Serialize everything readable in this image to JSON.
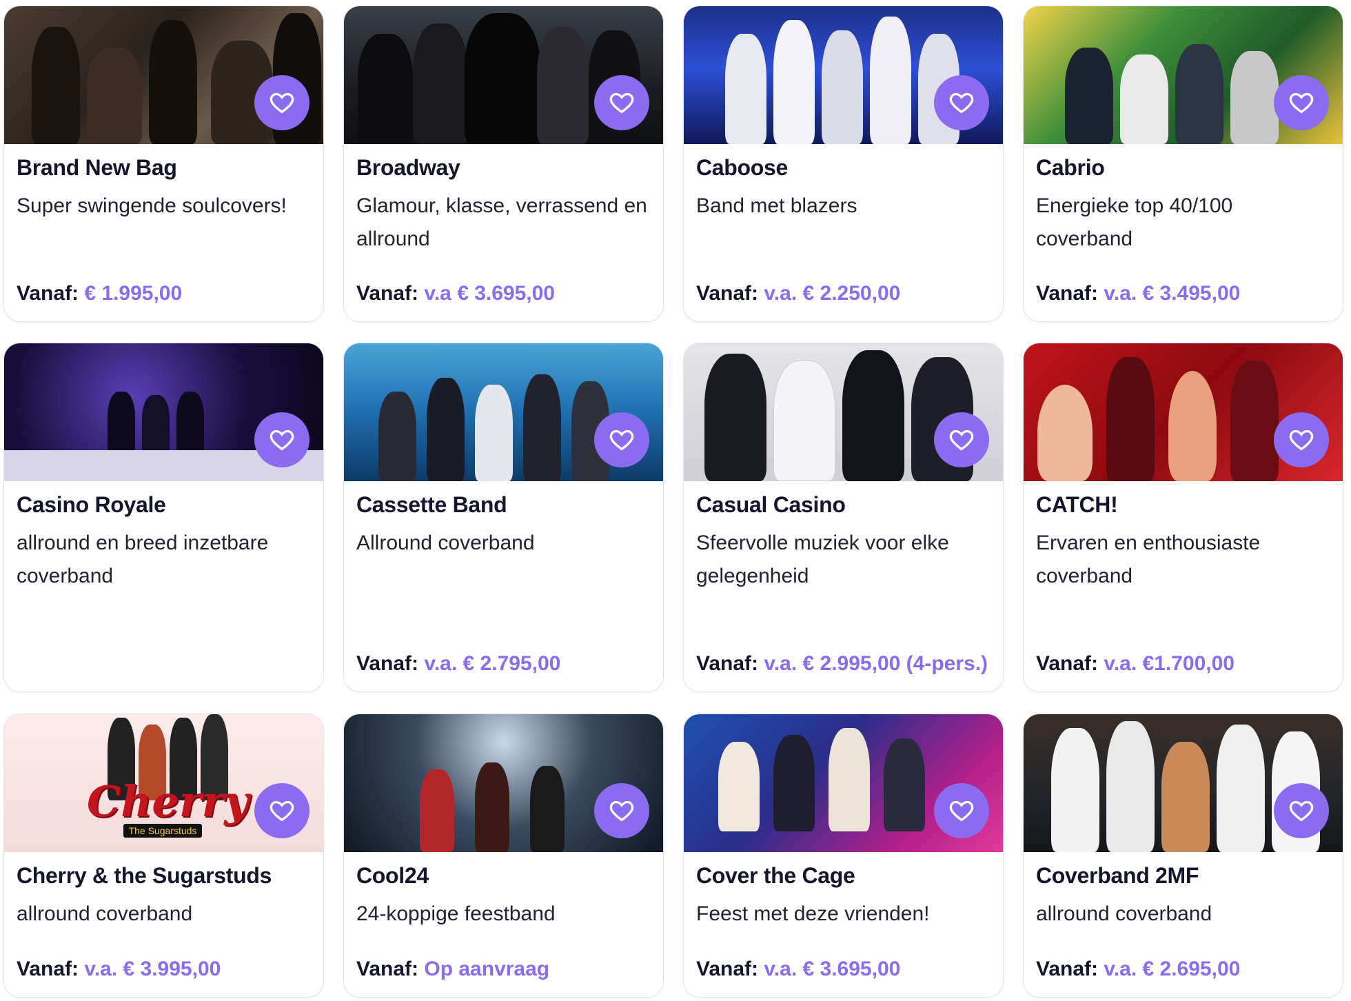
{
  "favorite_icon": "heart-icon",
  "accent_color": "#8b6cf0",
  "cards": [
    {
      "title": "Brand New Bag",
      "desc": "Super swingende soulcovers!",
      "price_label": "Vanaf:",
      "price": "€ 1.995,00"
    },
    {
      "title": "Broadway",
      "desc": "Glamour, klasse, verrassend en allround",
      "price_label": "Vanaf:",
      "price": "v.a € 3.695,00"
    },
    {
      "title": "Caboose",
      "desc": "Band met blazers",
      "price_label": "Vanaf:",
      "price": "v.a. € 2.250,00"
    },
    {
      "title": "Cabrio",
      "desc": "Energieke top 40/100 coverband",
      "price_label": "Vanaf:",
      "price": "v.a. € 3.495,00"
    },
    {
      "title": "Casino Royale",
      "desc": "allround en breed inzetbare coverband",
      "price_label": "",
      "price": ""
    },
    {
      "title": "Cassette Band",
      "desc": "Allround coverband",
      "price_label": "Vanaf:",
      "price": "v.a. € 2.795,00"
    },
    {
      "title": "Casual Casino",
      "desc": "Sfeervolle muziek voor elke gelegenheid",
      "price_label": "Vanaf:",
      "price": "v.a. € 2.995,00 (4-pers.)"
    },
    {
      "title": "CATCH!",
      "desc": "Ervaren en enthousiaste coverband",
      "price_label": "Vanaf:",
      "price": "v.a. €1.700,00"
    },
    {
      "title": "Cherry & the Sugarstuds",
      "desc": "allround coverband",
      "price_label": "Vanaf:",
      "price": "v.a. € 3.995,00",
      "logo_text": "Cherry",
      "logo_sub": "The Sugarstuds"
    },
    {
      "title": "Cool24",
      "desc": "24-koppige feestband",
      "price_label": "Vanaf:",
      "price": "Op aanvraag"
    },
    {
      "title": "Cover the Cage",
      "desc": "Feest met deze vrienden!",
      "price_label": "Vanaf:",
      "price": "v.a. € 3.695,00"
    },
    {
      "title": "Coverband 2MF",
      "desc": "allround coverband",
      "price_label": "Vanaf:",
      "price": "v.a. € 2.695,00"
    }
  ]
}
